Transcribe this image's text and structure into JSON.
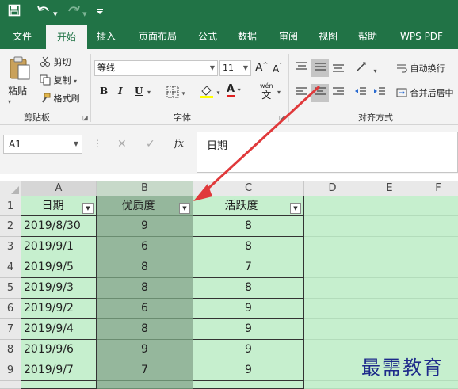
{
  "quick_access": {
    "save_icon": "save-icon",
    "undo_icon": "undo-icon",
    "redo_icon": "redo-icon",
    "customize_icon": "customize-icon"
  },
  "tabs": [
    {
      "label": "文件",
      "active": false
    },
    {
      "label": "开始",
      "active": true
    },
    {
      "label": "插入",
      "active": false
    },
    {
      "label": "页面布局",
      "active": false
    },
    {
      "label": "公式",
      "active": false
    },
    {
      "label": "数据",
      "active": false
    },
    {
      "label": "审阅",
      "active": false
    },
    {
      "label": "视图",
      "active": false
    },
    {
      "label": "帮助",
      "active": false
    },
    {
      "label": "WPS PDF",
      "active": false
    }
  ],
  "clipboard": {
    "paste": "粘贴",
    "cut": "剪切",
    "copy": "复制",
    "format_painter": "格式刷",
    "group_label": "剪贴板"
  },
  "font": {
    "name": "等线",
    "size": "11",
    "grow": "A",
    "shrink": "A",
    "bold": "B",
    "italic": "I",
    "underline": "U",
    "wen": "wén",
    "wen_char": "文",
    "font_color": "A",
    "group_label": "字体"
  },
  "alignment": {
    "wrap_text": "自动换行",
    "merge_center": "合并后居中",
    "group_label": "对齐方式"
  },
  "formula_bar": {
    "name_box": "A1",
    "cancel": "✕",
    "confirm": "✓",
    "fx": "fx",
    "content": "日期"
  },
  "sheet": {
    "columns": [
      "A",
      "B",
      "C",
      "D",
      "E",
      "F"
    ],
    "row_numbers": [
      "1",
      "2",
      "3",
      "4",
      "5",
      "6",
      "7",
      "8",
      "9"
    ],
    "headers": [
      "日期",
      "优质度",
      "活跃度"
    ],
    "rows": [
      [
        "2019/8/30",
        "9",
        "8"
      ],
      [
        "2019/9/1",
        "6",
        "8"
      ],
      [
        "2019/9/5",
        "8",
        "7"
      ],
      [
        "2019/9/3",
        "8",
        "8"
      ],
      [
        "2019/9/2",
        "6",
        "9"
      ],
      [
        "2019/9/4",
        "8",
        "9"
      ],
      [
        "2019/9/6",
        "9",
        "9"
      ],
      [
        "2019/9/7",
        "7",
        "9"
      ]
    ]
  },
  "watermark": "最需教育",
  "colors": {
    "brand": "#217346",
    "cell_green": "#c6efce",
    "selected_green": "#95b79c",
    "arrow": "#e0393b"
  }
}
